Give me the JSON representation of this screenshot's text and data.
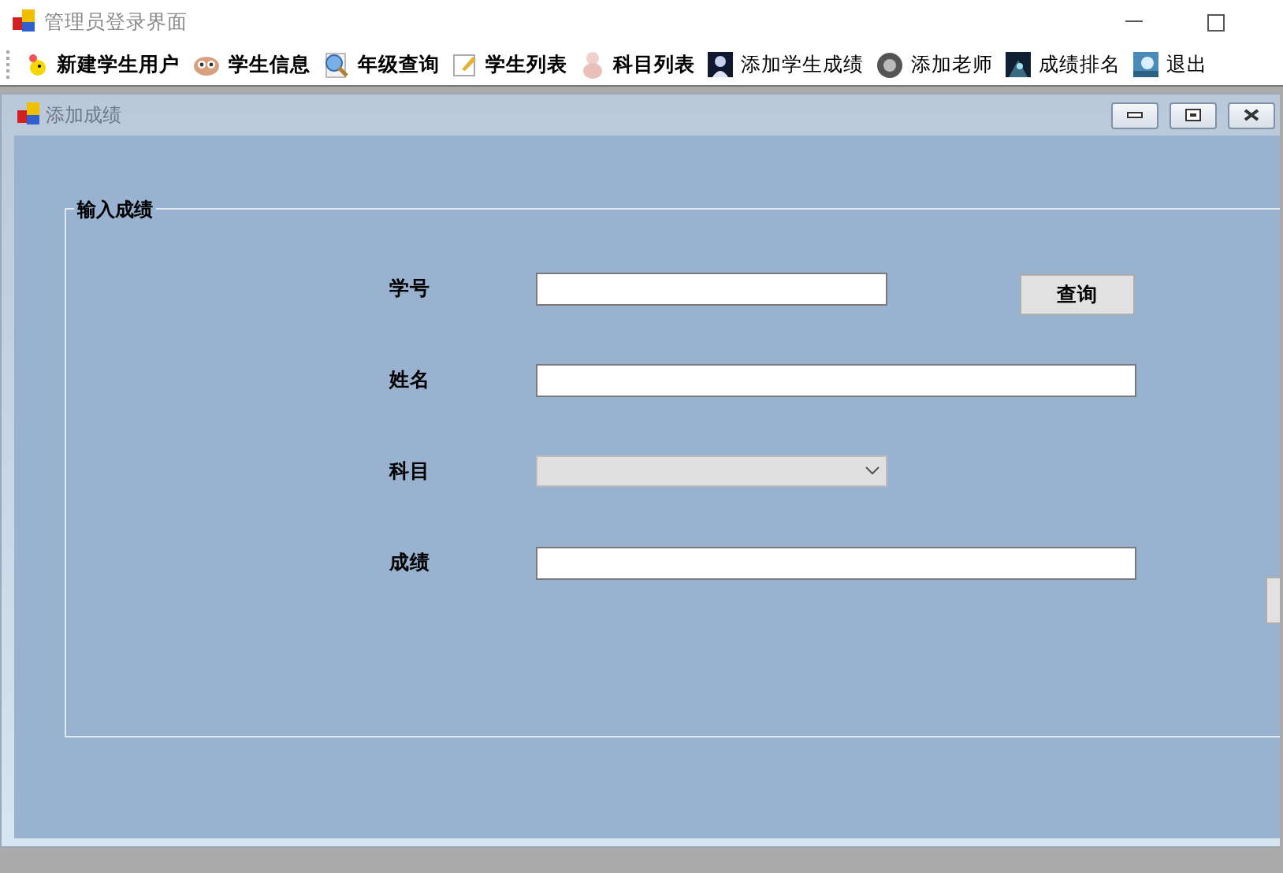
{
  "window": {
    "title": "管理员登录界面"
  },
  "toolbar": [
    {
      "label": "新建学生用户",
      "bold": true
    },
    {
      "label": "学生信息",
      "bold": true
    },
    {
      "label": "年级查询",
      "bold": true
    },
    {
      "label": "学生列表",
      "bold": true
    },
    {
      "label": "科目列表",
      "bold": true
    },
    {
      "label": "添加学生成绩",
      "bold": false
    },
    {
      "label": "添加老师",
      "bold": false
    },
    {
      "label": "成绩排名",
      "bold": false
    },
    {
      "label": "退出",
      "bold": false
    }
  ],
  "child_window": {
    "title": "添加成绩",
    "group": {
      "title": "输入成绩",
      "fields": [
        {
          "label": "学号",
          "kind": "text",
          "disabled": false
        },
        {
          "label": "姓名",
          "kind": "text",
          "disabled": false
        },
        {
          "label": "科目",
          "kind": "combo",
          "disabled": true
        },
        {
          "label": "成绩",
          "kind": "text",
          "disabled": false
        }
      ],
      "query_button": "查询"
    }
  }
}
